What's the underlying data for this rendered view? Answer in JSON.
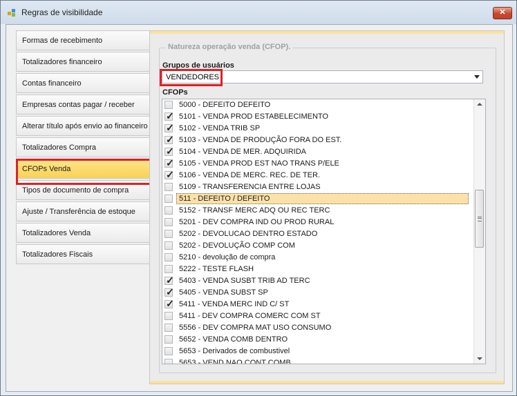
{
  "window": {
    "title": "Regras de visibilidade",
    "close_label": "✕"
  },
  "nav": {
    "items": [
      {
        "label": "Formas de recebimento"
      },
      {
        "label": "Totalizadores financeiro"
      },
      {
        "label": "Contas financeiro"
      },
      {
        "label": "Empresas contas pagar / receber"
      },
      {
        "label": "Alterar título após envio ao financeiro"
      },
      {
        "label": "Totalizadores Compra"
      },
      {
        "label": "CFOPs Venda",
        "active": true
      },
      {
        "label": "Tipos de documento de compra"
      },
      {
        "label": "Ajuste / Transferência de estoque"
      },
      {
        "label": "Totalizadores Venda"
      },
      {
        "label": "Totalizadores Fiscais"
      }
    ]
  },
  "panel": {
    "group_title": "Natureza operação venda (CFOP).",
    "groups_label": "Grupos de usuários",
    "groups_value": "VENDEDORES",
    "cfops_label": "CFOPs",
    "cfops": [
      {
        "label": "5000 - DEFEITO  DEFEITO",
        "checked": false
      },
      {
        "label": "5101 - VENDA PROD ESTABELECIMENTO",
        "checked": true
      },
      {
        "label": "5102 - VENDA TRIB SP",
        "checked": true
      },
      {
        "label": "5103 - VENDA DE PRODUÇÃO FORA DO EST.",
        "checked": true
      },
      {
        "label": "5104 - VENDA DE MER. ADQUIRIDA",
        "checked": true
      },
      {
        "label": "5105 - VENDA PROD EST NAO TRANS P/ELE",
        "checked": true
      },
      {
        "label": "5106 - VENDA DE MERC. REC. DE TER.",
        "checked": true
      },
      {
        "label": "5109 - TRANSFERENCIA ENTRE LOJAS",
        "checked": false
      },
      {
        "label": "511 - DEFEITO / DEFEITO",
        "checked": false,
        "selected": true
      },
      {
        "label": "5152 - TRANSF MERC ADQ OU REC TERC",
        "checked": false
      },
      {
        "label": "5201 - DEV COMPRA IND OU PROD RURAL",
        "checked": false
      },
      {
        "label": "5202 - DEVOLUCAO DENTRO ESTADO",
        "checked": false
      },
      {
        "label": "5202 - DEVOLUÇÃO COMP COM",
        "checked": false
      },
      {
        "label": "5210 - devolução de compra",
        "checked": false
      },
      {
        "label": "5222 - TESTE FLASH",
        "checked": false
      },
      {
        "label": "5403 - VENDA SUSBT TRIB AD TERC",
        "checked": true
      },
      {
        "label": "5405 - VENDA SUBST SP",
        "checked": true
      },
      {
        "label": "5411 - VENDA MERC IND C/ ST",
        "checked": true
      },
      {
        "label": "5411 - DEV COMPRA COMERC COM ST",
        "checked": false
      },
      {
        "label": "5556 - DEV COMPRA MAT USO CONSUMO",
        "checked": false
      },
      {
        "label": "5652 - VENDA COMB DENTRO",
        "checked": false
      },
      {
        "label": "5653 - Derivados de combustivel",
        "checked": false
      },
      {
        "label": "5653 - VEND NAO CONT COMB",
        "checked": false
      }
    ]
  },
  "colors": {
    "highlight": "#e01f26",
    "selected_tab": "#f9d257",
    "panel_accent": "#fbe39b"
  }
}
